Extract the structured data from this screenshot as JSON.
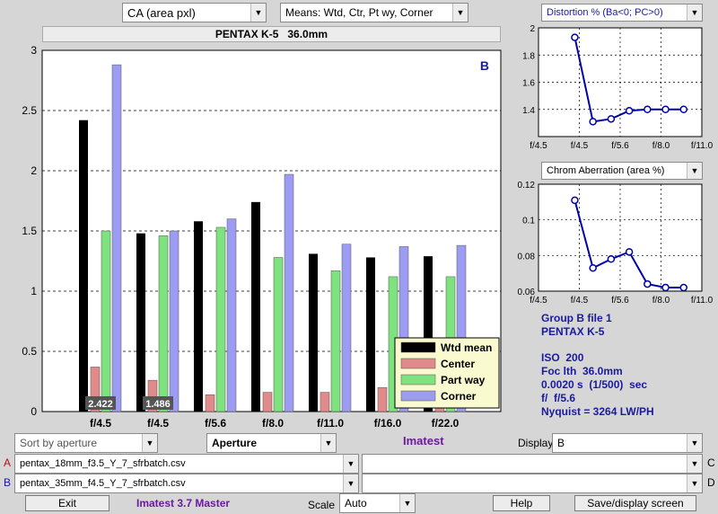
{
  "top": {
    "metric_select": "CA (area pxl)",
    "means_select": "Means: Wtd, Ctr, Pt wy, Corner",
    "camera_title": "PENTAX K-5   36.0mm"
  },
  "chart_data": [
    {
      "type": "bar",
      "title": "",
      "group_label": "B",
      "categories": [
        "f/4.5",
        "f/4.5",
        "f/5.6",
        "f/8.0",
        "f/11.0",
        "f/16.0",
        "f/22.0"
      ],
      "series": [
        {
          "name": "Wtd mean",
          "color": "#000000",
          "values": [
            2.42,
            1.48,
            1.58,
            1.74,
            1.31,
            1.28,
            1.29
          ]
        },
        {
          "name": "Center",
          "color": "#e08a8a",
          "values": [
            0.37,
            0.26,
            0.14,
            0.16,
            0.16,
            0.2,
            0.18
          ]
        },
        {
          "name": "Part way",
          "color": "#7ee27e",
          "values": [
            1.5,
            1.46,
            1.53,
            1.28,
            1.17,
            1.12,
            1.12
          ]
        },
        {
          "name": "Corner",
          "color": "#9c9cf2",
          "values": [
            2.88,
            1.5,
            1.6,
            1.97,
            1.39,
            1.37,
            1.38
          ]
        }
      ],
      "bar_value_labels": [
        "2.422",
        "1.486"
      ],
      "ylim": [
        0,
        3
      ],
      "yticks": [
        "0",
        "0.5",
        "1",
        "1.5",
        "2",
        "2.5",
        "3"
      ],
      "grid": true,
      "legend_position": "bottom-right"
    },
    {
      "type": "line",
      "title": "Distortion %  (Ba<0; PC>0)",
      "x": [
        4.8,
        5.2,
        5.6,
        6.0,
        6.4,
        6.8,
        7.2
      ],
      "y": [
        1.93,
        1.31,
        1.33,
        1.39,
        1.4,
        1.4,
        1.4
      ],
      "xlim": [
        4.0,
        7.6
      ],
      "xticks": [
        "f/4.5",
        "f/4.5",
        "f/5.6",
        "f/8.0",
        "f/11.0"
      ],
      "ylim": [
        1.2,
        2.0
      ],
      "yticks": [
        "1.4",
        "1.6",
        "1.8",
        "2"
      ],
      "color": "#0000aa"
    },
    {
      "type": "line",
      "title": "Chrom Aberration (area %)",
      "x": [
        4.8,
        5.2,
        5.6,
        6.0,
        6.4,
        6.8,
        7.2
      ],
      "y": [
        0.111,
        0.073,
        0.078,
        0.082,
        0.064,
        0.062,
        0.062
      ],
      "xlim": [
        4.0,
        7.6
      ],
      "xticks": [
        "f/4.5",
        "f/4.5",
        "f/5.6",
        "f/8.0",
        "f/11.0"
      ],
      "ylim": [
        0.06,
        0.12
      ],
      "yticks": [
        "0.06",
        "0.08",
        "0.1",
        "0.12"
      ],
      "color": "#0000aa"
    }
  ],
  "info": {
    "line1": "Group B file 1",
    "line2": "PENTAX K-5",
    "line3": "ISO  200",
    "line4": "Foc lth  36.0mm",
    "line5": "0.0020 s  (1/500)  sec",
    "line6": "f/  f/5.6",
    "line7": "Nyquist = 3264 LW/PH"
  },
  "controls": {
    "sort_select": "Sort by aperture",
    "x_select": "Aperture",
    "brand": "Imatest",
    "display_label": "Display",
    "display_select": "B",
    "row_a_label": "A",
    "row_a_file": "pentax_18mm_f3.5_Y_7_sfrbatch.csv",
    "row_b_label": "B",
    "row_b_file": "pentax_35mm_f4.5_Y_7_sfrbatch.csv",
    "row_c_label": "C",
    "row_d_label": "D",
    "exit_label": "Exit",
    "version": "Imatest 3.7 Master",
    "scale_label": "Scale",
    "scale_select": "Auto",
    "help_label": "Help",
    "save_label": "Save/display screen"
  },
  "icons": {
    "dropdown": "chevron-down-icon"
  }
}
